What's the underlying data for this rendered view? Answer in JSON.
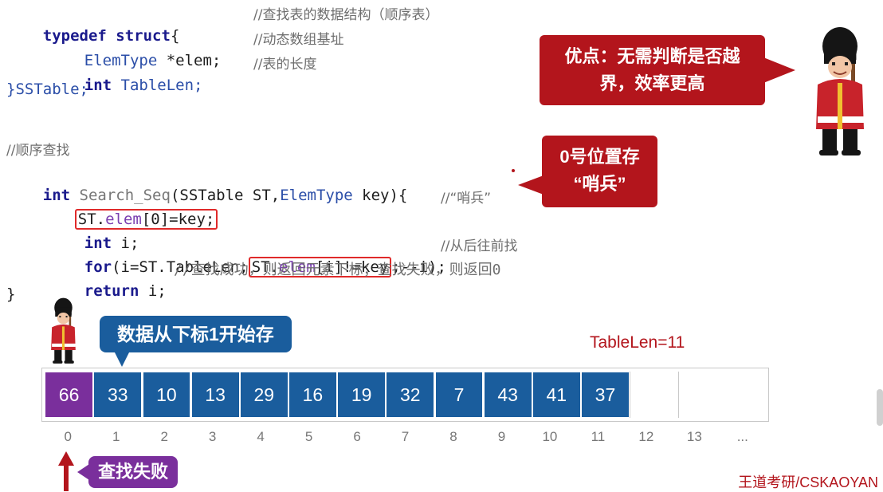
{
  "code": {
    "l1": {
      "kw1": "typedef",
      "kw2": "struct",
      "brace": "{",
      "comment": "//查找表的数据结构（顺序表）"
    },
    "l2": {
      "type": "ElemType",
      "rest": " *elem;",
      "comment": "//动态数组基址"
    },
    "l3": {
      "kw": "int",
      "name": " TableLen;",
      "comment": "//表的长度"
    },
    "l4": {
      "text": "}SSTable;"
    },
    "l5": {
      "comment": "//顺序查找"
    },
    "l6": {
      "kw": "int",
      "fn": " Search_Seq",
      "p1": "(SSTable ST,",
      "type": "ElemType",
      "p2": " key){"
    },
    "l7": {
      "st": "ST.",
      "fld": "elem",
      "rest": "[0]=key;",
      "comment": "//“哨兵”"
    },
    "l8": {
      "kw": "int",
      "rest": " i;"
    },
    "l9": {
      "kw": "for",
      "p1": "(i=ST.TableLen;",
      "st": "ST.",
      "fld": "elem",
      "cond": "[i]!=key",
      "p2": ";--i);",
      "comment": "//从后往前找"
    },
    "l10": {
      "kw": "return",
      "rest": " i;",
      "comment": "//查找成功，则返回元素下标；查找失败，则返回0"
    },
    "l11": {
      "text": "}"
    }
  },
  "callouts": {
    "advantage": [
      "优点：无需判断是否越",
      "界，效率更高"
    ],
    "sentinel": [
      "0号位置存",
      "“哨兵”"
    ],
    "store_from_1": "数据从下标1开始存",
    "search_failed": "查找失败"
  },
  "tablelen_label": "TableLen=11",
  "array": {
    "values": [
      "66",
      "33",
      "10",
      "13",
      "29",
      "16",
      "19",
      "32",
      "7",
      "43",
      "41",
      "37",
      "",
      ""
    ],
    "indices": [
      "0",
      "1",
      "2",
      "3",
      "4",
      "5",
      "6",
      "7",
      "8",
      "9",
      "10",
      "11",
      "12",
      "13",
      "..."
    ]
  },
  "watermark": "王道考研/CSKAOYAN",
  "colors": {
    "red": "#b3151c",
    "blue": "#1a5d9d",
    "purple": "#7a2f9c"
  },
  "icons": [
    "guard-large-icon",
    "guard-small-icon",
    "arrow-up-icon"
  ]
}
